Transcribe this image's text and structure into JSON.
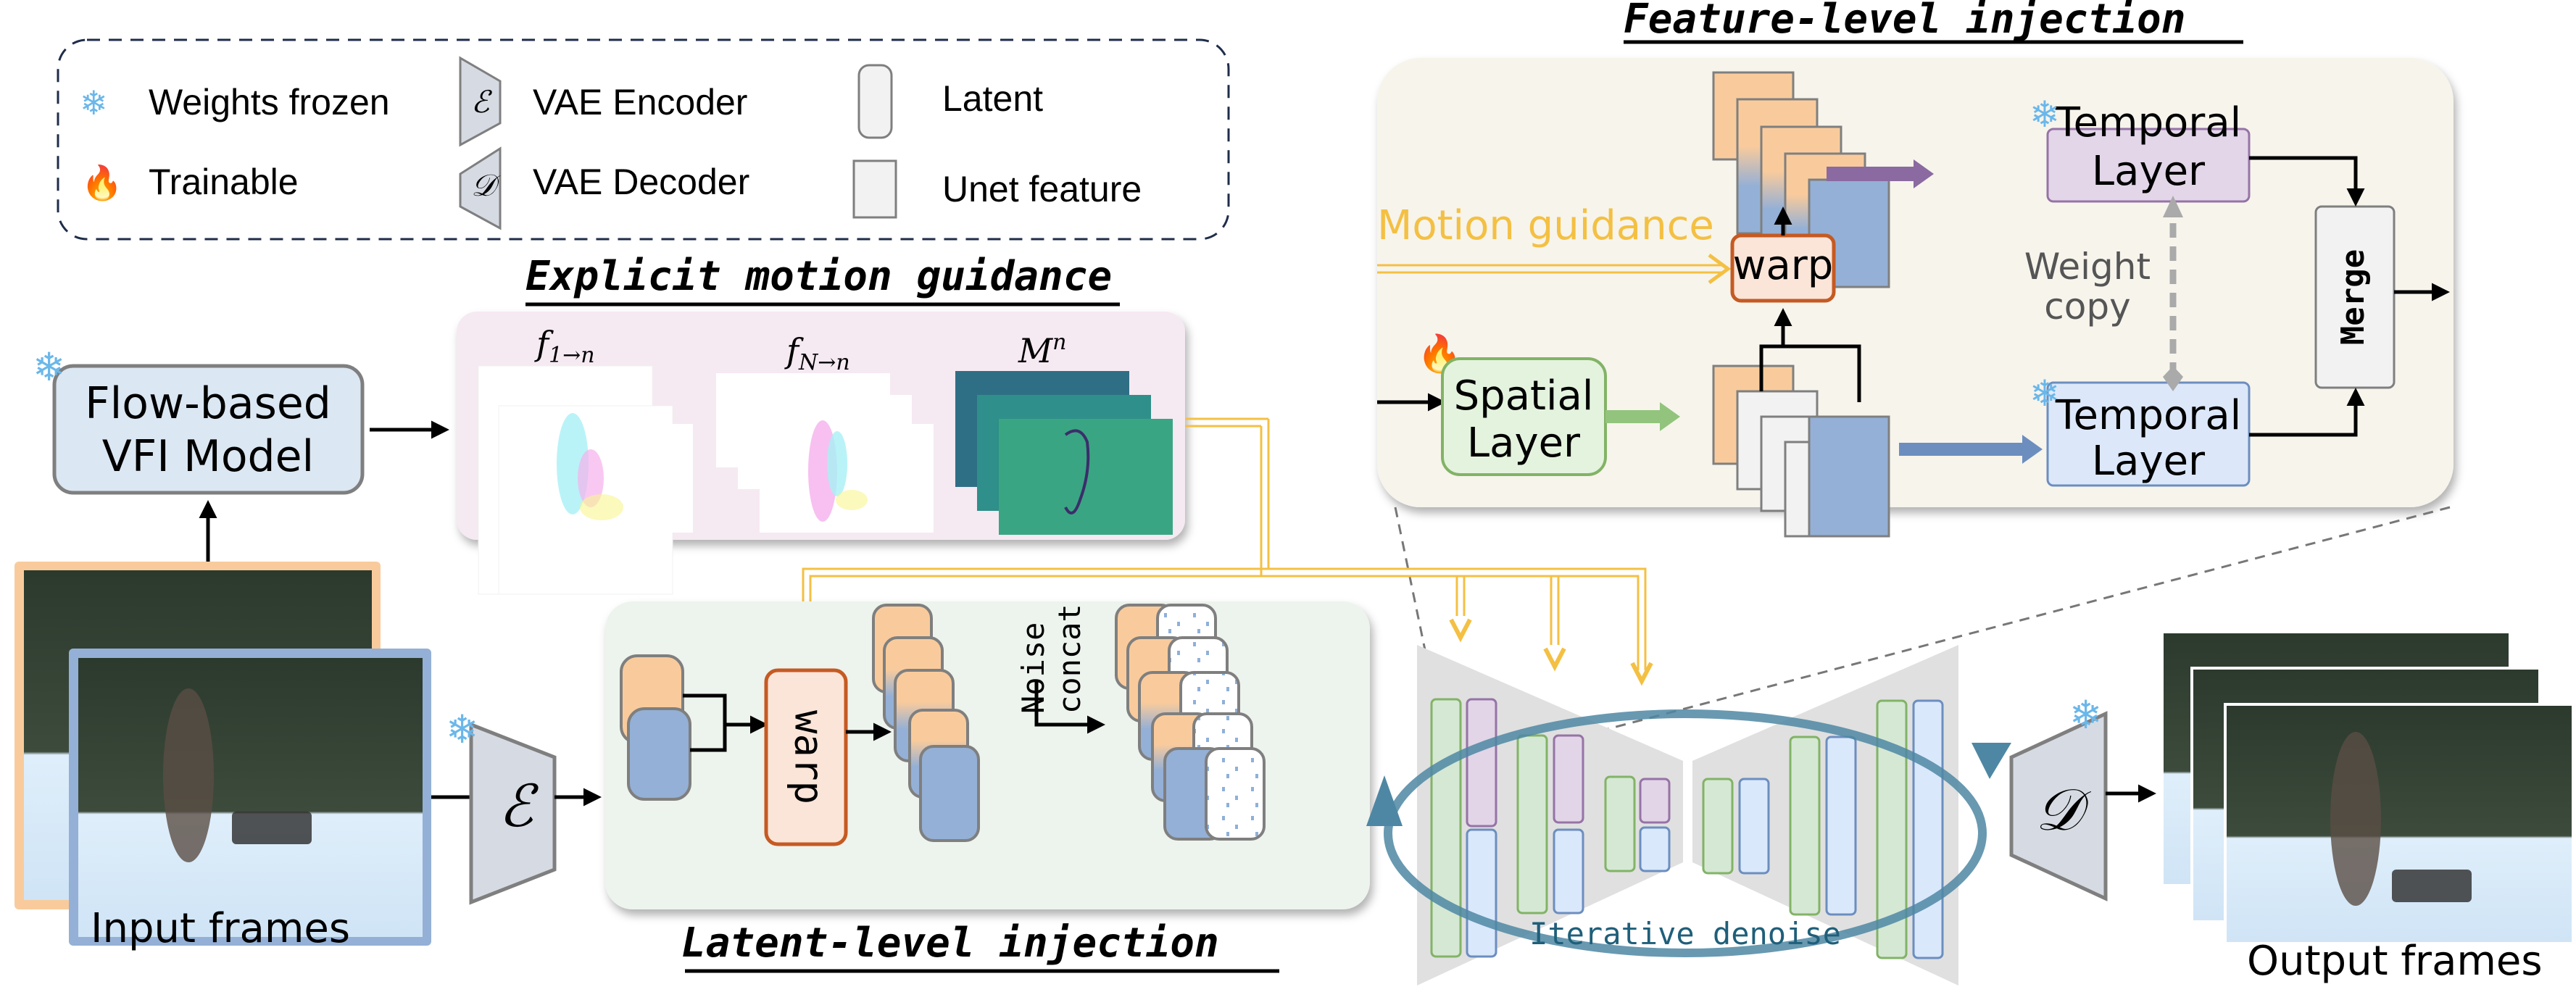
{
  "legend": {
    "items": [
      {
        "icon": "snowflake-icon",
        "label": "Weights frozen"
      },
      {
        "icon": "fire-icon",
        "label": "Trainable"
      },
      {
        "icon": "encoder-trapezoid-icon",
        "symbol": "ℰ",
        "label": "VAE Encoder"
      },
      {
        "icon": "decoder-trapezoid-icon",
        "symbol": "𝒟",
        "label": "VAE Decoder"
      },
      {
        "icon": "latent-rounded-box-icon",
        "label": "Latent"
      },
      {
        "icon": "unet-feature-box-icon",
        "label": "Unet feature"
      }
    ]
  },
  "titles": {
    "feature_level": "Feature-level injection",
    "explicit_motion": "Explicit motion guidance",
    "latent_level": "Latent-level injection"
  },
  "vfi_model": {
    "line1": "Flow-based",
    "line2": "VFI Model"
  },
  "motion_guidance": {
    "flow_forward_label": "f",
    "flow_forward_sub": "1→n",
    "flow_backward_label": "f",
    "flow_backward_sub": "N→n",
    "mask_label": "M",
    "mask_sup": "n"
  },
  "feature_panel": {
    "motion_guidance_label": "Motion guidance",
    "warp_label": "warp",
    "spatial_layer": {
      "line1": "Spatial",
      "line2": "Layer"
    },
    "temporal_layer_top": {
      "line1": "Temporal",
      "line2": "Layer"
    },
    "temporal_layer_bottom": {
      "line1": "Temporal",
      "line2": "Layer"
    },
    "weight_copy": {
      "line1": "Weight",
      "line2": "copy"
    },
    "merge_label": "Merge"
  },
  "latent_panel": {
    "warp_label": "warp",
    "noise_concat": {
      "line1": "Noise",
      "line2": "concat"
    }
  },
  "unet": {
    "loop_label": "Iterative denoise"
  },
  "encoder_symbol": "ℰ",
  "decoder_symbol": "𝒟",
  "input_frames_label": "Input frames",
  "output_frames_label": "Output frames",
  "colors": {
    "orange_latent": "#f9cb9c",
    "blue_latent": "#94b0d6",
    "guidance_yellow": "#f4c043",
    "warp_border": "#c55a22",
    "warp_fill": "#fbe5d9",
    "spatial_green": "#e4f3de",
    "temporal_purple": "#e2d6e8",
    "temporal_blue": "#dce8f9",
    "loop_teal": "#4e87a3"
  }
}
